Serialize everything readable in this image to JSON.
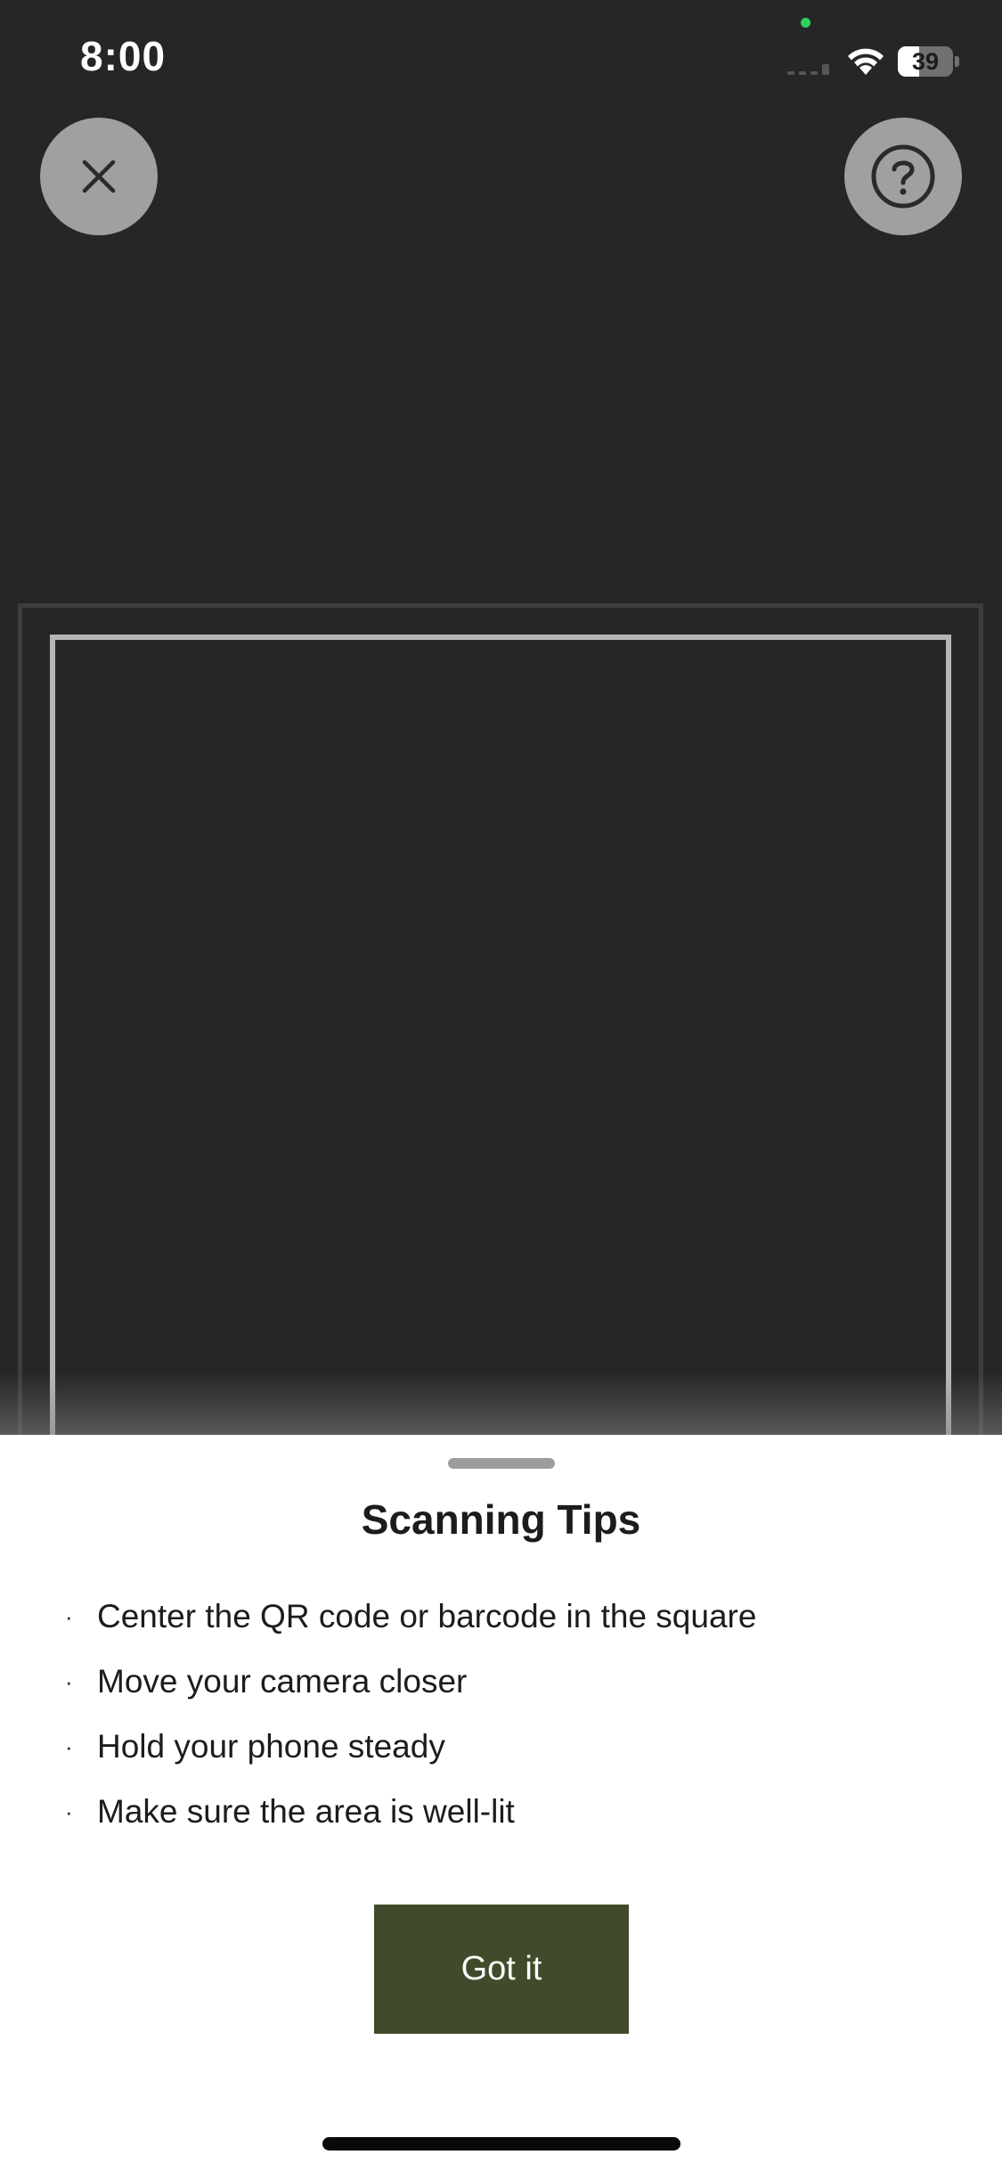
{
  "status_bar": {
    "time": "8:00",
    "battery_level": "39",
    "battery_fraction": 0.39,
    "icons": [
      "signal-icon",
      "wifi-icon",
      "battery-icon"
    ]
  },
  "top_controls": {
    "close_icon": "close-icon",
    "help_icon": "help-icon"
  },
  "colors": {
    "background": "#262628",
    "button_bg": "#a0a0a2",
    "primary_button": "#414b2b",
    "privacy_dot": "#30d158"
  },
  "sheet": {
    "title": "Scanning Tips",
    "bullet": "·",
    "tips": [
      "Center the QR code or barcode in the square",
      "Move your camera closer",
      "Hold your phone steady",
      "Make sure the area is well-lit"
    ],
    "button_label": "Got it"
  }
}
